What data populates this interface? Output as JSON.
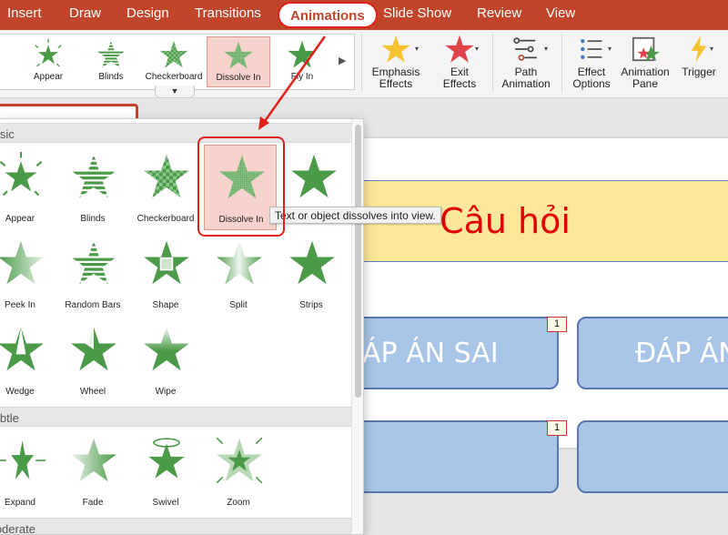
{
  "tabs": [
    {
      "label": "Insert"
    },
    {
      "label": "Draw"
    },
    {
      "label": "Design"
    },
    {
      "label": "Transitions"
    },
    {
      "label": "Animations",
      "active": true
    },
    {
      "label": "Slide Show"
    },
    {
      "label": "Review"
    },
    {
      "label": "View"
    }
  ],
  "ribbon": {
    "gallery": [
      {
        "label": "Appear",
        "icon": "appear-star-icon"
      },
      {
        "label": "Blinds",
        "icon": "blinds-star-icon"
      },
      {
        "label": "Checkerboard",
        "icon": "checkerboard-star-icon"
      },
      {
        "label": "Dissolve In",
        "icon": "dissolve-star-icon",
        "selected": true
      },
      {
        "label": "Fly In",
        "icon": "fly-in-star-icon"
      }
    ],
    "emphasis": {
      "line1": "Emphasis",
      "line2": "Effects"
    },
    "exit": {
      "line1": "Exit",
      "line2": "Effects"
    },
    "path": {
      "line1": "Path",
      "line2": "Animation"
    },
    "options": {
      "line1": "Effect",
      "line2": "Options"
    },
    "pane": {
      "line1": "Animation",
      "line2": "Pane"
    },
    "trigger": {
      "line1": "Trigger"
    }
  },
  "panel": {
    "sections": {
      "basic": "Basic",
      "subtle": "Subtle",
      "moderate": "Moderate"
    },
    "basic": [
      {
        "label": "Appear",
        "icon": "appear-star-icon"
      },
      {
        "label": "Blinds",
        "icon": "blinds-star-icon"
      },
      {
        "label": "Checkerboard",
        "icon": "checkerboard-star-icon"
      },
      {
        "label": "Dissolve In",
        "icon": "dissolve-star-icon",
        "selected": true
      },
      {
        "label": "Strips",
        "icon": "strips-star-icon"
      },
      {
        "label": "Peek In",
        "icon": "peek-in-star-icon"
      },
      {
        "label": "Random Bars",
        "icon": "random-bars-star-icon"
      },
      {
        "label": "Shape",
        "icon": "shape-star-icon"
      },
      {
        "label": "Split",
        "icon": "split-star-icon"
      },
      {
        "label": "Strips",
        "icon": "strips-star-icon"
      },
      {
        "label": "Wedge",
        "icon": "wedge-star-icon"
      },
      {
        "label": "Wheel",
        "icon": "wheel-star-icon"
      },
      {
        "label": "Wipe",
        "icon": "wipe-star-icon"
      }
    ],
    "subtle": [
      {
        "label": "Expand",
        "icon": "expand-star-icon"
      },
      {
        "label": "Fade",
        "icon": "fade-star-icon"
      },
      {
        "label": "Swivel",
        "icon": "swivel-star-icon"
      },
      {
        "label": "Zoom",
        "icon": "zoom-star-icon"
      }
    ]
  },
  "tooltip": "Text or object dissolves into view.",
  "slide": {
    "question": "Câu hỏi",
    "answer_wrong": "ÁP ÁN SAI",
    "answer_right": "ĐÁP ÁN",
    "badges": [
      "1",
      "1"
    ]
  },
  "colors": {
    "accent": "#c0452b",
    "star": "#4a9a48",
    "highlight": "#e0201a"
  }
}
